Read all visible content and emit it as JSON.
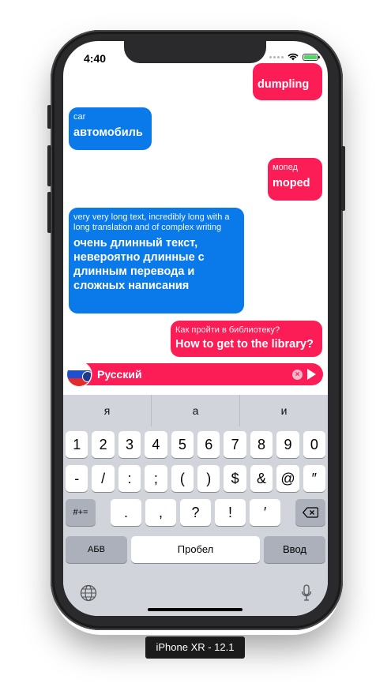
{
  "status_bar": {
    "time": "4:40"
  },
  "messages": [
    {
      "side": "right",
      "color": "red",
      "source": "",
      "translation": "dumpling"
    },
    {
      "side": "left",
      "color": "blue",
      "source": "car",
      "translation": "автомобиль"
    },
    {
      "side": "right",
      "color": "red",
      "source": "мопед",
      "translation": "moped"
    },
    {
      "side": "left",
      "color": "blue",
      "source": "very very long text, incredibly long with a long translation and of complex writing",
      "translation": "очень длинный текст, невероятно длинные с длинным перевода и сложных написания"
    },
    {
      "side": "right",
      "color": "red",
      "source": "Как пройти в библиотеку?",
      "translation": "How to get to the library?"
    }
  ],
  "input_bar": {
    "language": "Русский",
    "flag_icon": "russia-flag-icon"
  },
  "keyboard": {
    "suggestions": [
      "я",
      "а",
      "и"
    ],
    "row1": [
      "1",
      "2",
      "3",
      "4",
      "5",
      "6",
      "7",
      "8",
      "9",
      "0"
    ],
    "row2": [
      "-",
      "/",
      ":",
      ";",
      "(",
      ")",
      "$",
      "&",
      "@",
      "″"
    ],
    "row3_left": "#+=",
    "row3": [
      ".",
      ",",
      "?",
      "!",
      "′"
    ],
    "abc_label": "АБВ",
    "space_label": "Пробел",
    "return_label": "Ввод"
  },
  "device_label": "iPhone XR - 12.1",
  "colors": {
    "blue": "#0a7aea",
    "red": "#fc1d57"
  }
}
